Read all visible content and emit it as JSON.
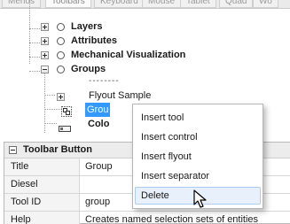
{
  "tabs": [
    "Menus",
    "Toolbars",
    "Keyboard",
    "Mouse",
    "Tablet",
    "Quad",
    "Wo"
  ],
  "tree": {
    "nodes": [
      {
        "label": "Layers",
        "icon": "circle-icon"
      },
      {
        "label": "Attributes",
        "icon": "circle-icon"
      },
      {
        "label": "Mechanical Visualization",
        "icon": "circle-icon"
      },
      {
        "label": "Groups",
        "icon": "circle-icon"
      },
      {
        "label": "--------",
        "icon": ""
      },
      {
        "label": "Flyout Sample",
        "icon": ""
      },
      {
        "label": "Grou",
        "icon": "group-tool-icon"
      },
      {
        "label": "Colo",
        "icon": "toolbar-icon"
      }
    ]
  },
  "properties": {
    "section_title": "Toolbar Button",
    "rows": [
      {
        "key": "Title",
        "value": "Group"
      },
      {
        "key": "Diesel",
        "value": ""
      },
      {
        "key": "Tool ID",
        "value": "group"
      },
      {
        "key": "Help",
        "value": "Creates named selection sets of entities"
      }
    ]
  },
  "context_menu": {
    "items": [
      "Insert tool",
      "Insert control",
      "Insert flyout",
      "Insert separator",
      "Delete"
    ],
    "hovered": "Delete"
  },
  "colors": {
    "selection": "#3399ff",
    "menu_hover_bg": "#e8f0fb",
    "menu_hover_border": "#aecbf0"
  }
}
